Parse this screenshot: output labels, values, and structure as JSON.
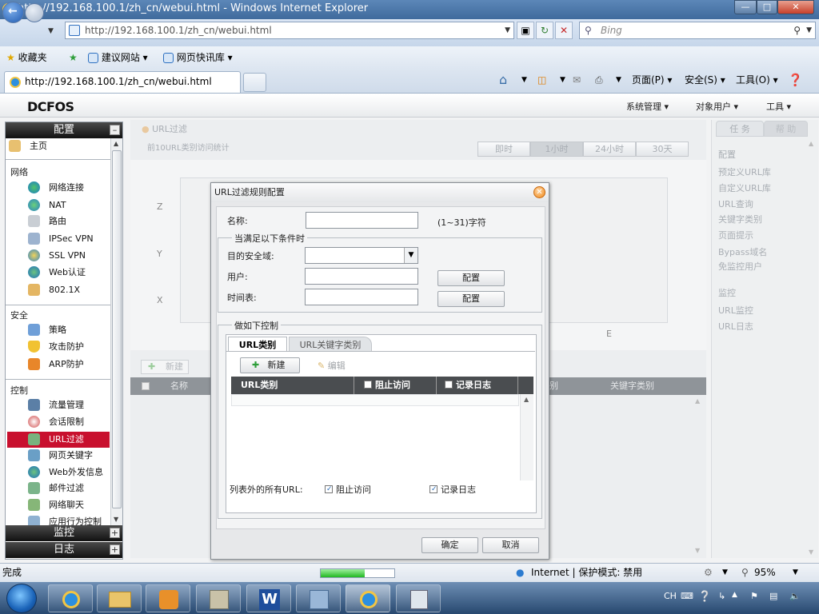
{
  "window": {
    "title": "http://192.168.100.1/zh_cn/webui.html - Windows Internet Explorer"
  },
  "browser": {
    "url": "http://192.168.100.1/zh_cn/webui.html",
    "search_placeholder": "Bing",
    "favorites": [
      "收藏夹",
      "建议网站",
      "网页快讯库"
    ],
    "tab_title": "http://192.168.100.1/zh_cn/webui.html",
    "commands": [
      "页面(P)",
      "安全(S)",
      "工具(O)"
    ]
  },
  "app": {
    "logo": "DCFOS",
    "top_menu": [
      "系统管理",
      "对象用户",
      "工具"
    ]
  },
  "sidebar": {
    "config_title": "配置",
    "home": "主页",
    "sections": [
      {
        "title": "网络",
        "items": [
          "网络连接",
          "NAT",
          "路由",
          "IPSec VPN",
          "SSL VPN",
          "Web认证",
          "802.1X"
        ]
      },
      {
        "title": "安全",
        "items": [
          "策略",
          "攻击防护",
          "ARP防护"
        ]
      },
      {
        "title": "控制",
        "items": [
          "流量管理",
          "会话限制",
          "URL过滤",
          "网页关键字",
          "Web外发信息",
          "邮件过滤",
          "网络聊天",
          "应用行为控制"
        ]
      }
    ],
    "active_item": "URL过滤",
    "monitor_title": "监控",
    "log_title": "日志"
  },
  "main": {
    "breadcrumb": "URL过滤",
    "chart_title": "前10URL类别访问统计",
    "time_buttons": [
      "即时",
      "1小时",
      "24小时",
      "30天"
    ],
    "axis_labels": [
      "Z",
      "Y",
      "X",
      "E"
    ],
    "new_button": "新建",
    "grid_headers": [
      "名称",
      "别",
      "关键字类别"
    ]
  },
  "rightpanel": {
    "tabs": [
      "任 务",
      "帮 助"
    ],
    "config_title": "配置",
    "config_items": [
      "预定义URL库",
      "自定义URL库",
      "URL查询",
      "关键字类别",
      "页面提示",
      "Bypass域名",
      "免监控用户"
    ],
    "monitor_title": "监控",
    "monitor_items": [
      "URL监控",
      "URL日志"
    ]
  },
  "dialog": {
    "title": "URL过滤规则配置",
    "name_label": "名称:",
    "name_hint": "(1~31)字符",
    "condition_legend": "当满足以下条件时",
    "zone_label": "目的安全域:",
    "user_label": "用户:",
    "schedule_label": "时间表:",
    "config_button": "配置",
    "action_legend": "做如下控制",
    "tabs": [
      "URL类别",
      "URL关键字类别"
    ],
    "new_button": "新建",
    "edit_button": "编辑",
    "grid_headers": [
      "URL类别",
      "阻止访问",
      "记录日志"
    ],
    "all_urls_label": "列表外的所有URL:",
    "block_label": "阻止访问",
    "log_label": "记录日志",
    "ok_button": "确定",
    "cancel_button": "取消"
  },
  "statusbar": {
    "status": "完成",
    "zone": "Internet | 保护模式: 禁用",
    "zoom": "95%",
    "progress_fraction": 0.6
  },
  "taskbar": {
    "lang": "CH"
  }
}
